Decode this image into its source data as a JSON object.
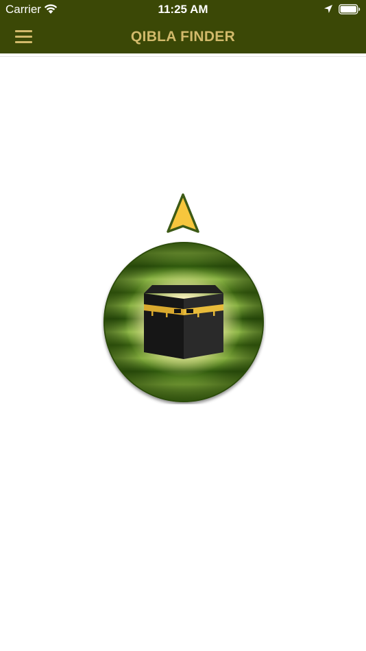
{
  "status_bar": {
    "carrier": "Carrier",
    "time": "11:25 AM",
    "icons": [
      "wifi-icon",
      "location-arrow-icon",
      "battery-icon"
    ]
  },
  "nav_bar": {
    "title": "QIBLA FINDER",
    "menu_icon": "hamburger-menu-icon"
  },
  "compass": {
    "pointer_icon": "qibla-direction-arrow-icon",
    "center_icon": "kaaba-icon"
  },
  "colors": {
    "nav_background": "#3b4806",
    "title_text": "#d2ba6b",
    "menu_icon": "#d2ba6b",
    "arrow_fill": "#f6c63d",
    "arrow_stroke": "#3d5a16",
    "compass_green": "#4d7a1c",
    "kaaba_gold": "#d9a92e"
  }
}
